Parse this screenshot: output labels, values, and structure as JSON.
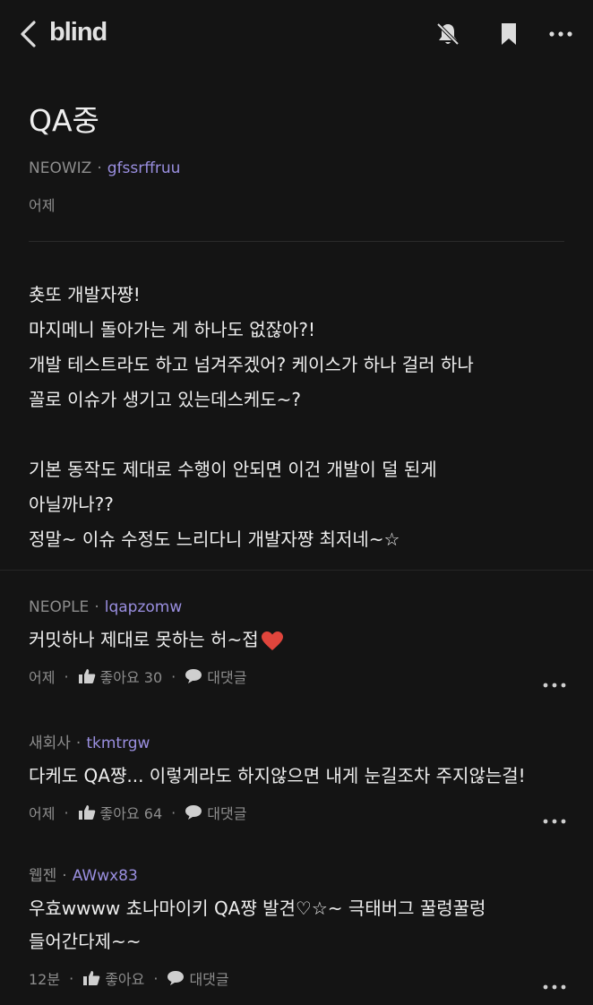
{
  "app": {
    "logo": "blind"
  },
  "post": {
    "title": "QA중",
    "company": "NEOWIZ",
    "author": "gfssrffruu",
    "time": "어제",
    "body_lines": [
      "춋또 개발자쨩!",
      "마지메니 돌아가는 게 하나도 없잖아?!",
      "개발 테스트라도 하고 넘겨주겠어? 케이스가 하나 걸러 하나",
      "꼴로 이슈가 생기고 있는데스케도~?",
      "",
      "기본 동작도 제대로 수행이 안되면 이건 개발이 덜 된게",
      "아닐까나??",
      "정말~ 이슈 수정도 느리다니 개발자쨩 최저네~☆"
    ]
  },
  "comments": [
    {
      "company": "NEOPLE",
      "author": "lqapzomw",
      "lines": [
        "커밋하나 제대로 못하는 허~접"
      ],
      "time": "어제",
      "like_label": "좋아요 30",
      "reply_label": "대댓글"
    },
    {
      "company": "새회사",
      "author": "tkmtrgw",
      "lines": [
        "다케도 QA쨩... 이렇게라도 하지않으면 내게 눈길조차 주지않는걸!"
      ],
      "time": "어제",
      "like_label": "좋아요 64",
      "reply_label": "대댓글"
    },
    {
      "company": "웹젠",
      "author": "AWwx83",
      "lines": [
        "우효wwww 쵸나마이키 QA쨩 발견♡☆~ 극태버그 꿀렁꿀렁",
        "들어간다제~~"
      ],
      "time": "12분",
      "like_label": "좋아요",
      "reply_label": "대댓글"
    }
  ],
  "icons": {
    "back": "chevron-left-icon",
    "bell": "bell-off-icon",
    "bookmark": "bookmark-icon",
    "more": "more-horizontal-icon",
    "like": "thumbs-up-icon",
    "reply": "speech-bubble-icon",
    "heart": "heart-icon"
  },
  "colors": {
    "background": "#141414",
    "username": "#9a8fe0",
    "muted": "#8d8d8d",
    "heart": "#e0453c"
  }
}
